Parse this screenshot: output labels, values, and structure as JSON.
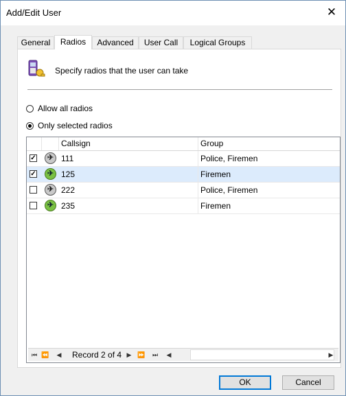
{
  "window": {
    "title": "Add/Edit User"
  },
  "tabs": [
    {
      "label": "General"
    },
    {
      "label": "Radios"
    },
    {
      "label": "Advanced"
    },
    {
      "label": "User Call"
    },
    {
      "label": "Logical Groups"
    }
  ],
  "header": {
    "text": "Specify radios that the user can take"
  },
  "options": {
    "allow_all": "Allow all radios",
    "only_selected": "Only selected radios",
    "selected": "only_selected"
  },
  "grid": {
    "columns": [
      "Callsign",
      "Group"
    ],
    "rows": [
      {
        "checked": true,
        "status": "gray",
        "callsign": "111",
        "group": "Police, Firemen"
      },
      {
        "checked": true,
        "status": "green",
        "callsign": "125",
        "group": "Firemen"
      },
      {
        "checked": false,
        "status": "gray",
        "callsign": "222",
        "group": "Police, Firemen"
      },
      {
        "checked": false,
        "status": "green",
        "callsign": "235",
        "group": "Firemen"
      }
    ],
    "navigator": {
      "record_text": "Record 2 of 4"
    }
  },
  "buttons": {
    "ok": "OK",
    "cancel": "Cancel"
  }
}
